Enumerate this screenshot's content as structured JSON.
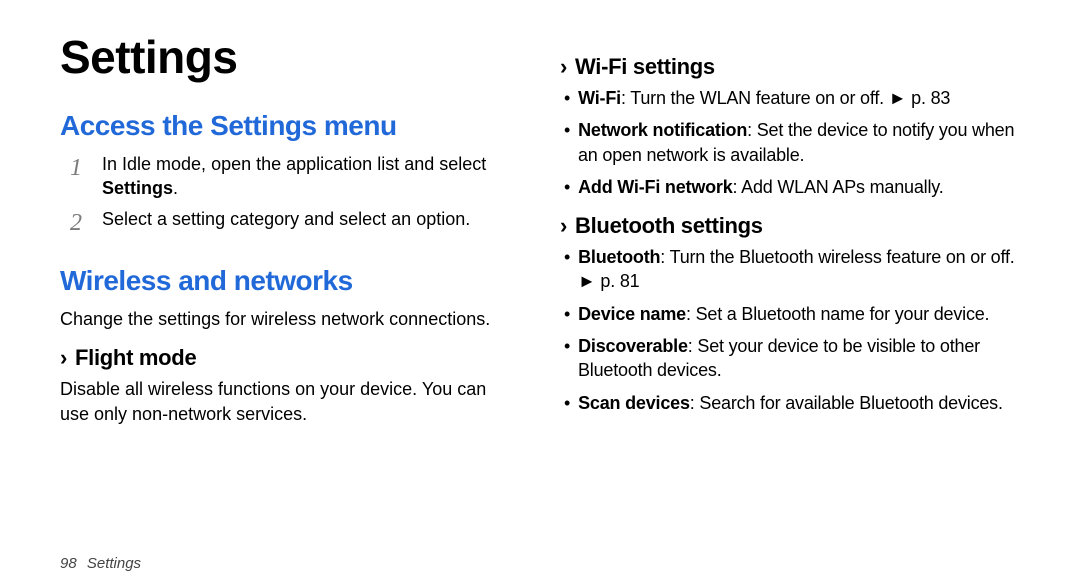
{
  "title": "Settings",
  "col1": {
    "access": {
      "heading": "Access the Settings menu",
      "step1_pre": "In Idle mode, open the application list and select ",
      "step1_bold": "Settings",
      "step1_post": ".",
      "step2": "Select a setting category and select an option."
    },
    "wireless": {
      "heading": "Wireless and networks",
      "desc": "Change the settings for wireless network connections."
    },
    "flight": {
      "heading": "Flight mode",
      "desc": "Disable all wireless functions on your device. You can use only non-network services."
    }
  },
  "col2": {
    "wifi": {
      "heading": "Wi-Fi settings",
      "b1_bold": "Wi-Fi",
      "b1_text": ": Turn the WLAN feature on or off. ► p. 83",
      "b2_bold": "Network notification",
      "b2_text": ": Set the device to notify you when an open network is available.",
      "b3_bold": "Add Wi-Fi network",
      "b3_text": ": Add WLAN APs manually."
    },
    "bt": {
      "heading": "Bluetooth settings",
      "b1_bold": "Bluetooth",
      "b1_text": ": Turn the Bluetooth wireless feature on or off. ► p. 81",
      "b2_bold": "Device name",
      "b2_text": ": Set a Bluetooth name for your device.",
      "b3_bold": "Discoverable",
      "b3_text": ": Set your device to be visible to other Bluetooth devices.",
      "b4_bold": "Scan devices",
      "b4_text": ": Search for available Bluetooth devices."
    }
  },
  "footer": {
    "page_num": "98",
    "section": "Settings"
  },
  "icons": {
    "chevron": "›"
  }
}
